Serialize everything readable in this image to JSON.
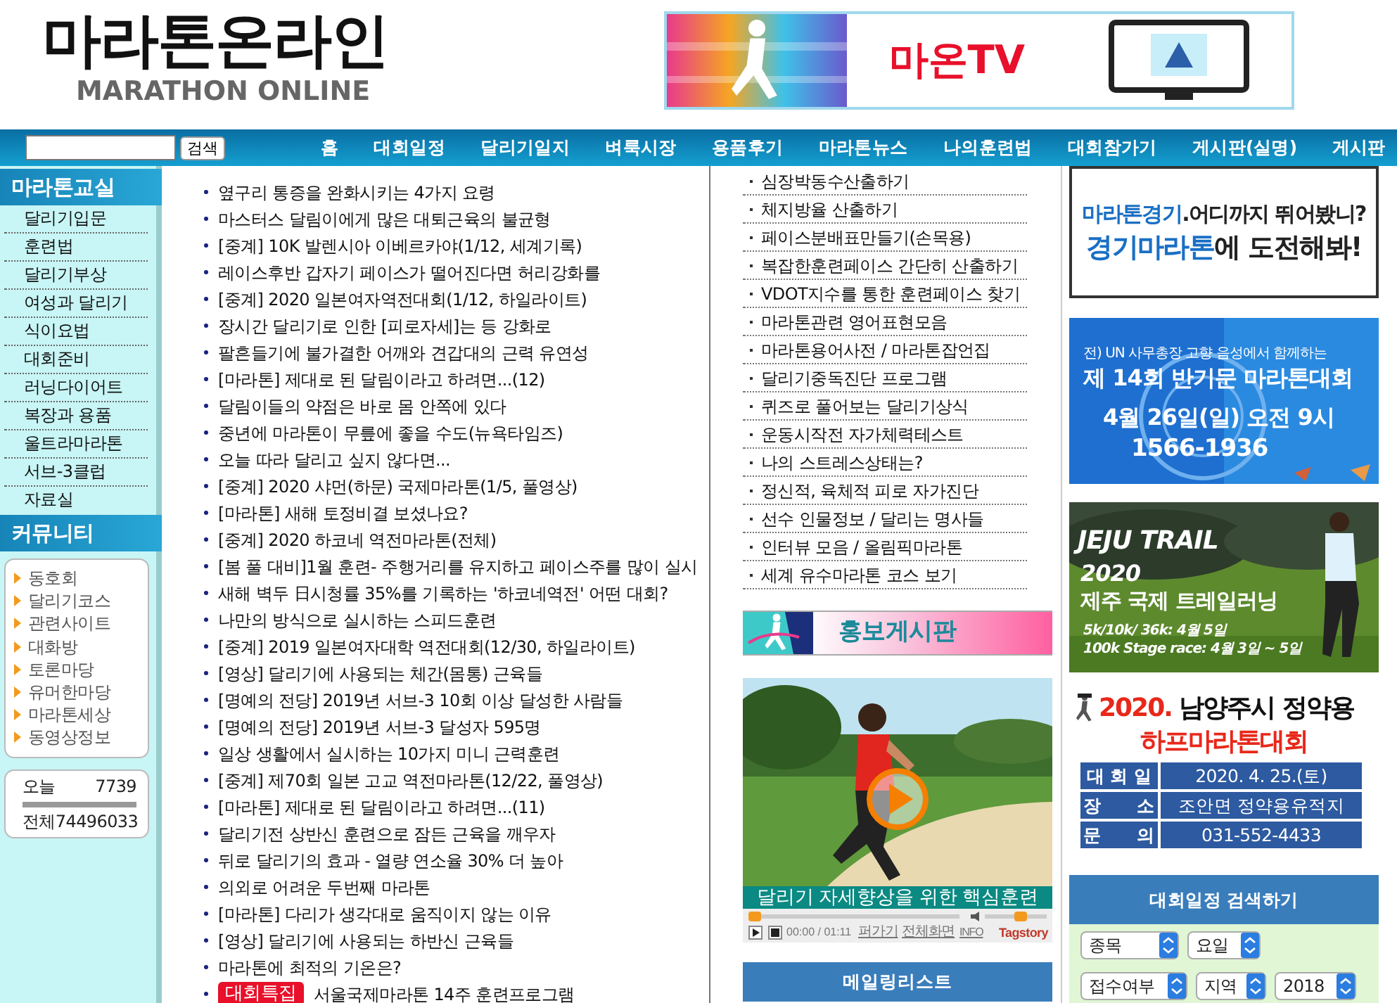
{
  "logo": {
    "title": "마라톤온라인",
    "subtitle": "MARATHON ONLINE"
  },
  "top_banner": {
    "text": "마온TV"
  },
  "search": {
    "button": "검색"
  },
  "nav": [
    "홈",
    "대회일정",
    "달리기일지",
    "벼룩시장",
    "용품후기",
    "마라톤뉴스",
    "나의훈련법",
    "대회참가기",
    "게시판(실명)",
    "게시판"
  ],
  "sidebar": [
    {
      "title": "마라톤교실",
      "kind": "menu",
      "items": [
        "달리기입문",
        "훈련법",
        "달리기부상",
        "여성과 달리기",
        "식이요법",
        "대회준비",
        "러닝다이어트",
        "복장과 용품",
        "울트라마라톤",
        "서브-3클럽",
        "자료실"
      ]
    },
    {
      "title": "커뮤니티",
      "kind": "box",
      "items": [
        "동호회",
        "달리기코스",
        "관련사이트",
        "대화방",
        "토론마당",
        "유머한마당",
        "마라톤세상",
        "동영상정보"
      ]
    }
  ],
  "counter": [
    {
      "label": "오늘",
      "value": "7739"
    },
    {
      "label": "전체",
      "value": "74496033"
    }
  ],
  "articles": [
    {
      "text": "옆구리 통증을 완화시키는 4가지 요령"
    },
    {
      "text": "마스터스 달림이에게 많은 대퇴근육의 불균형"
    },
    {
      "text": "[중계] 10K 발렌시아 이베르카야(1/12, 세계기록)"
    },
    {
      "text": "레이스후반 갑자기 페이스가 떨어진다면 허리강화를"
    },
    {
      "text": "[중계] 2020 일본여자역전대회(1/12, 하일라이트)"
    },
    {
      "text": "장시간 달리기로 인한 [피로자세]는 등 강화로"
    },
    {
      "text": "팔흔들기에 불가결한 어깨와 견갑대의 근력 유연성"
    },
    {
      "text": "[마라톤] 제대로 된 달림이라고 하려면...(12)"
    },
    {
      "text": "달림이들의 약점은 바로 몸 안쪽에 있다"
    },
    {
      "text": "중년에 마라톤이 무릎에 좋을 수도(뉴욕타임즈)"
    },
    {
      "text": "오늘 따라 달리고 싶지 않다면..."
    },
    {
      "text": "[중계] 2020 샤먼(하문) 국제마라톤(1/5, 풀영상)"
    },
    {
      "text": "[마라톤] 새해 토정비결 보셨나요?"
    },
    {
      "text": "[중계] 2020 하코네 역전마라톤(전체)"
    },
    {
      "text": "[봄 풀 대비]1월 훈련- 주행거리를 유지하고 페이스주를 많이 실시"
    },
    {
      "text": "새해 벽두 日시청률 35%를 기록하는 '하코네역전' 어떤 대회?"
    },
    {
      "text": "나만의 방식으로 실시하는 스피드훈련"
    },
    {
      "text": "[중계] 2019 일본여자대학 역전대회(12/30, 하일라이트)"
    },
    {
      "text": "[영상] 달리기에 사용되는 체간(몸통) 근육들"
    },
    {
      "text": "[명예의 전당] 2019년 서브-3 10회 이상 달성한 사람들"
    },
    {
      "text": "[명예의 전당] 2019년 서브-3 달성자 595명"
    },
    {
      "text": "일상 생활에서 실시하는 10가지 미니 근력훈련"
    },
    {
      "text": "[중계] 제70회 일본 고교 역전마라톤(12/22, 풀영상)"
    },
    {
      "text": "[마라톤] 제대로 된 달림이라고 하려면...(11)"
    },
    {
      "text": "달리기전 상반신 훈련으로 잠든 근육을 깨우자"
    },
    {
      "text": "뒤로 달리기의 효과 - 열량 연소율 30% 더 높아"
    },
    {
      "text": "의외로 어려운 두번째 마라톤"
    },
    {
      "text": "[마라톤] 다리가 생각대로 움직이지 않는 이유"
    },
    {
      "text": "[영상] 달리기에 사용되는 하반신 근육들"
    },
    {
      "text": "마라톤에 최적의 기온은?"
    },
    {
      "text": "서울국제마라톤 14주 훈련프로그램",
      "tag": "대회특집"
    }
  ],
  "tools": [
    "심장박동수산출하기",
    "체지방율 산출하기",
    "페이스분배표만들기(손목용)",
    "복잡한훈련페이스 간단히 산출하기",
    "VDOT지수를 통한 훈련페이스 찾기",
    "마라톤관련 영어표현모음",
    "마라톤용어사전 / 마라톤잡언집",
    "달리기중독진단 프로그램",
    "퀴즈로 풀어보는 달리기상식",
    "운동시작전 자가체력테스트",
    "나의 스트레스상태는?",
    "정신적, 육체적 피로 자가진단",
    "선수 인물정보 / 달리는 명사들",
    "인터뷰 모음 / 올림픽마라톤",
    "세계 유수마라톤 코스 보기"
  ],
  "promo": {
    "title": "홍보게시판"
  },
  "video": {
    "caption": "달리기 자세향상을 위한 핵심훈련",
    "progress": {
      "level": 0
    },
    "volume": {
      "level": 0.6
    },
    "time": "00:00 / 01:11",
    "links": [
      "퍼가기",
      "전체화면",
      "INFO"
    ],
    "brand": "Tagstory"
  },
  "mailing": {
    "label": "메일링리스트"
  },
  "banners": [
    {
      "kind": "slogan",
      "lines": [
        [
          {
            "text": "마라톤경기",
            "accent": true
          },
          {
            "text": ".어디까지 뛰어봤니?",
            "accent": false
          }
        ],
        [
          {
            "text": "경기마라톤",
            "accent": true
          },
          {
            "text": "에 도전해봐!",
            "accent": false
          }
        ]
      ]
    },
    {
      "kind": "event",
      "lines": [
        "전) UN 사무총장 고향 음성에서 함께하는",
        "제 14회 반기문 마라톤대회",
        "4월 26일(일) 오전 9시",
        "1566-1936"
      ]
    },
    {
      "lines": [
        "JEJU TRAIL",
        "2020",
        "제주 국제 트레일러닝",
        "5k/10k/ 36k: 4월 5일",
        "100k Stage race: 4월 3일 ~ 5일"
      ]
    },
    {
      "kind": "table",
      "title": [
        {
          "text": "2020.",
          "accent": true
        },
        {
          "text": " 남양주시 정약용",
          "accent": false
        }
      ],
      "subtitle": "하프마라톤대회",
      "rows": [
        [
          "대 회 일",
          "2020. 4. 25.(토)"
        ],
        [
          "장　　소",
          "조안면 정약용유적지"
        ],
        [
          "문　　의",
          "031-552-4433"
        ]
      ]
    }
  ],
  "schedule_search": {
    "title": "대회일정 검색하기",
    "rows": [
      [
        "종목",
        "요일"
      ],
      [
        "접수여부",
        "지역",
        "2018"
      ]
    ]
  }
}
